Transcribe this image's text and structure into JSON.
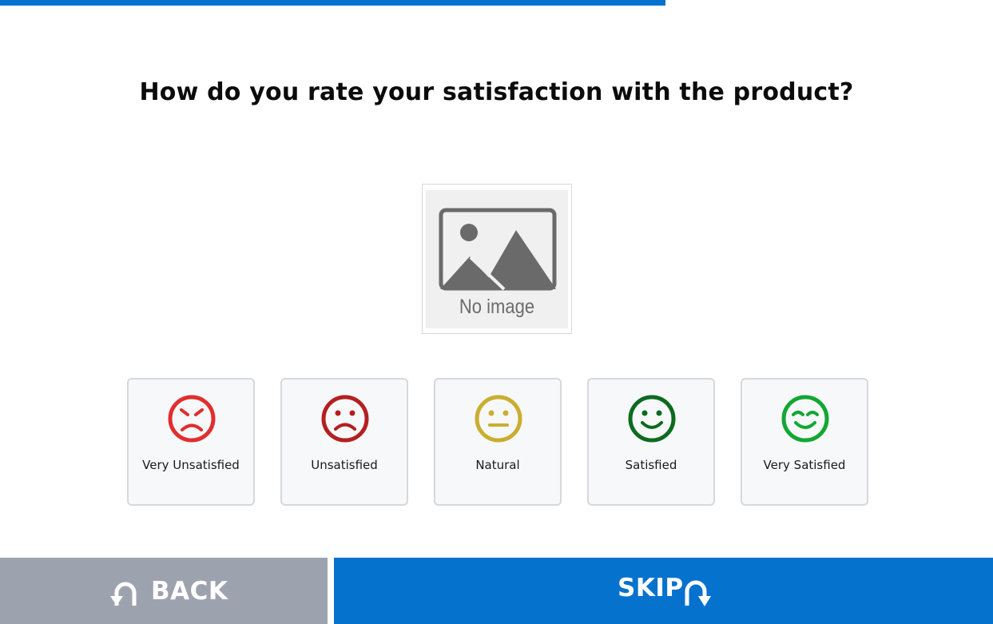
{
  "progress": {
    "fraction": 0.67
  },
  "question": {
    "text": "How do you rate your satisfaction with the product?"
  },
  "image": {
    "placeholder_text": "No image"
  },
  "options": [
    {
      "label": "Very Unsatisfied",
      "icon": "angry-face-icon",
      "color": "#e02f2f"
    },
    {
      "label": "Unsatisfied",
      "icon": "sad-face-icon",
      "color": "#b3201f"
    },
    {
      "label": "Natural",
      "icon": "neutral-face-icon",
      "color": "#c9ae30"
    },
    {
      "label": "Satisfied",
      "icon": "smile-face-icon",
      "color": "#0c6b1e"
    },
    {
      "label": "Very Satisfied",
      "icon": "happy-face-icon",
      "color": "#11a832"
    }
  ],
  "nav": {
    "back_label": "BACK",
    "skip_label": "SKIP",
    "back_icon": "undo-arrow-icon",
    "skip_icon": "redo-arrow-icon"
  },
  "colors": {
    "accent": "#0572cd",
    "back_bg": "#9da3ae",
    "card_bg": "#f7f8fa",
    "card_border": "#d5d8dd"
  }
}
